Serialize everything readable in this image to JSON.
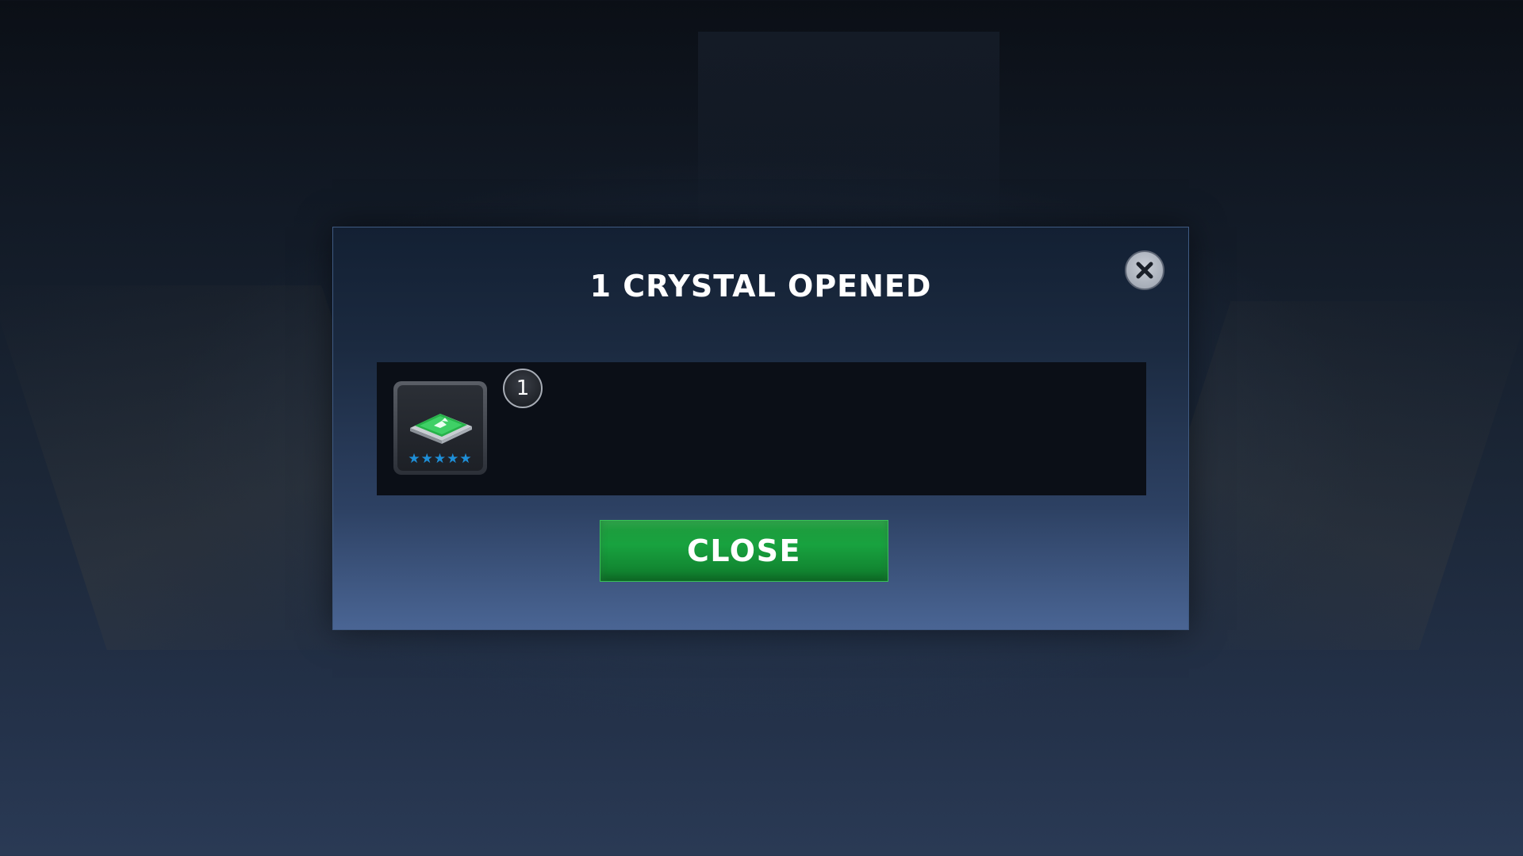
{
  "dialog": {
    "title": "1 CRYSTAL OPENED",
    "close_icon": "close-icon",
    "close_button_label": "CLOSE",
    "button_color": "#18a23f"
  },
  "rewards": [
    {
      "icon": "training-module-icon",
      "count": "1",
      "stars": "★★★★★",
      "star_rating": 5,
      "star_color": "#1e8fd8"
    }
  ]
}
